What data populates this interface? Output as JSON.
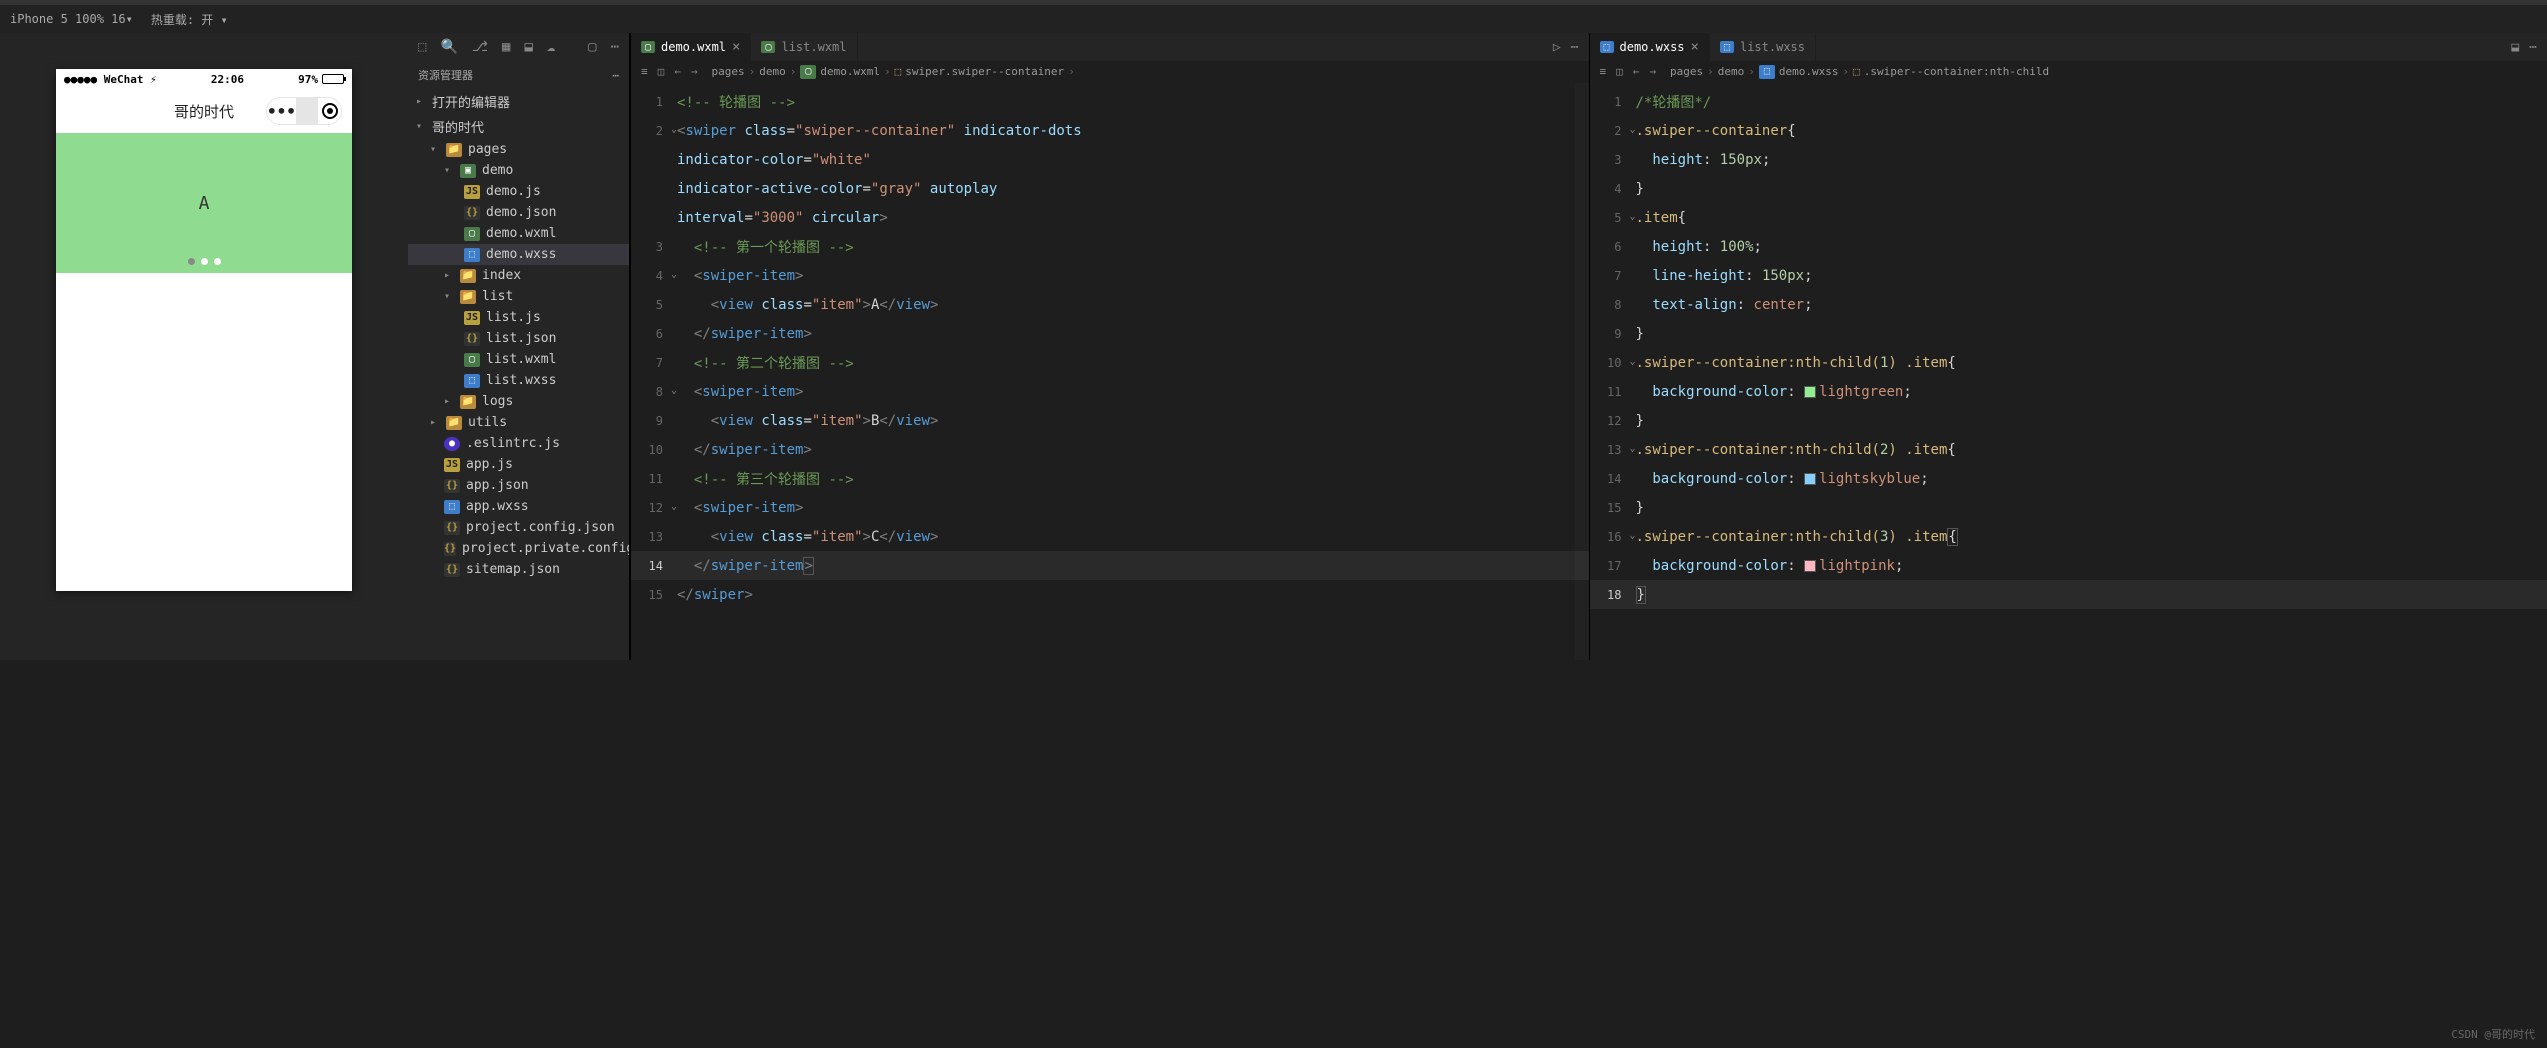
{
  "statusbar": {
    "device": "iPhone 5 100% 16▾",
    "reload": "热重载: 开 ▾"
  },
  "phone": {
    "carrier": "●●●●● WeChat ⚡",
    "time": "22:06",
    "battery": "97%",
    "title": "哥的时代",
    "swiper_text": "A"
  },
  "explorer": {
    "title": "资源管理器",
    "section_editors": "打开的编辑器",
    "section_project": "哥的时代",
    "tree": {
      "pages": "pages",
      "demo": "demo",
      "demo_js": "demo.js",
      "demo_json": "demo.json",
      "demo_wxml": "demo.wxml",
      "demo_wxss": "demo.wxss",
      "index": "index",
      "list": "list",
      "list_js": "list.js",
      "list_json": "list.json",
      "list_wxml": "list.wxml",
      "list_wxss": "list.wxss",
      "logs": "logs",
      "utils": "utils",
      "eslintrc": ".eslintrc.js",
      "app_js": "app.js",
      "app_json": "app.json",
      "app_wxss": "app.wxss",
      "project_config": "project.config.json",
      "project_private": "project.private.config.json",
      "sitemap": "sitemap.json"
    }
  },
  "editor1": {
    "tabs": {
      "t1": "demo.wxml",
      "t2": "list.wxml"
    },
    "breadcrumb": {
      "p1": "pages",
      "p2": "demo",
      "p3": "demo.wxml",
      "p4": "swiper.swiper--container"
    },
    "lines": {
      "1": "轮播图",
      "3a": "第一个轮播图",
      "3b": "第二个轮播图",
      "3c": "第三个轮播图",
      "interval": "3000",
      "cls": "swiper--container",
      "white": "white",
      "gray": "gray",
      "item": "item"
    }
  },
  "editor2": {
    "tabs": {
      "t1": "demo.wxss",
      "t2": "list.wxss"
    },
    "breadcrumb": {
      "p1": "pages",
      "p2": "demo",
      "p3": "demo.wxss",
      "p4": ".swiper--container:nth-child"
    },
    "css": {
      "comment": "/*轮播图*/",
      "sel1": ".swiper--container",
      "height": "height",
      "h150": "150px",
      "item": ".item",
      "h100": "100%",
      "lh": "line-height",
      "ta": "text-align",
      "center": "center",
      "nth": ".swiper--container",
      "bg": "background-color",
      "lg": "lightgreen",
      "lsb": "lightskyblue",
      "lp": "lightpink"
    }
  },
  "watermark": "CSDN @哥的时代"
}
